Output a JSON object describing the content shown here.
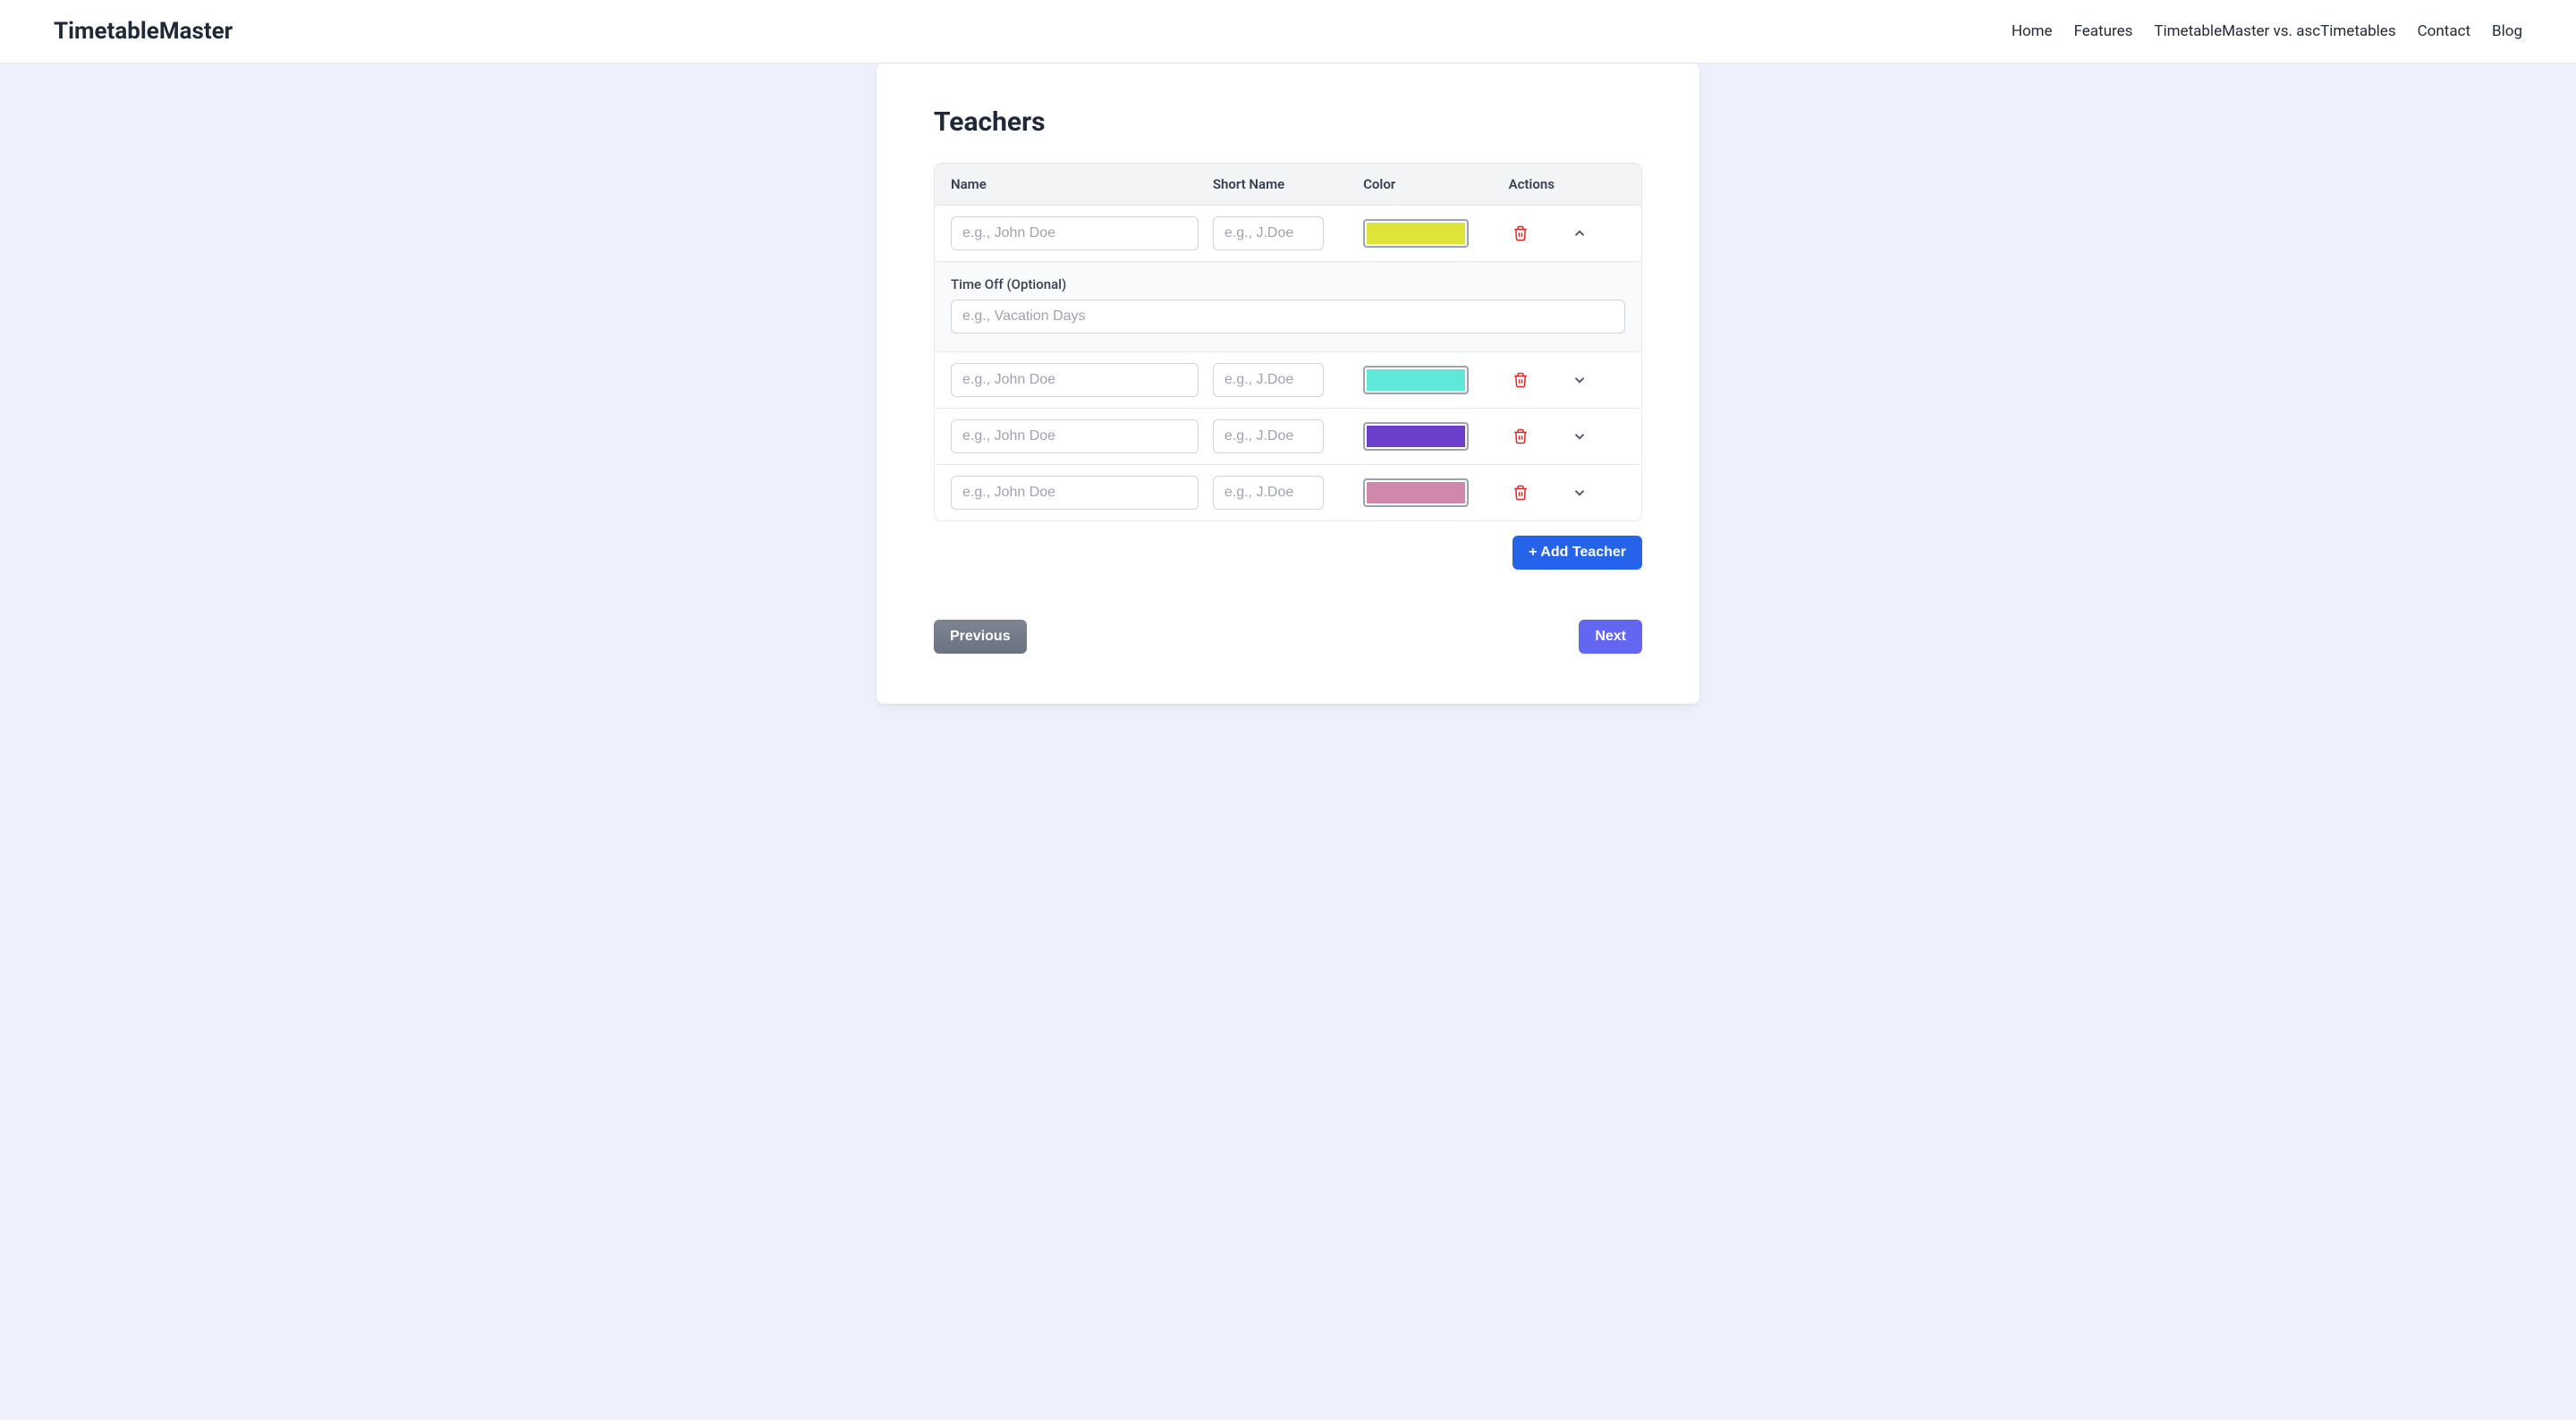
{
  "nav": {
    "logo": "TimetableMaster",
    "links": [
      "Home",
      "Features",
      "TimetableMaster vs. ascTimetables",
      "Contact",
      "Blog"
    ]
  },
  "card": {
    "title": "Teachers",
    "columns": [
      "Name",
      "Short Name",
      "Color",
      "Actions"
    ],
    "name_placeholder": "e.g., John Doe",
    "short_name_placeholder": "e.g., J.Doe",
    "timeoff_label": "Time Off (Optional)",
    "timeoff_placeholder": "e.g., Vacation Days",
    "rows": [
      {
        "color": "#dde53b",
        "expanded": true
      },
      {
        "color": "#5fe7da",
        "expanded": false
      },
      {
        "color": "#6a3fc9",
        "expanded": false
      },
      {
        "color": "#cf87ac",
        "expanded": false
      }
    ],
    "add_button": "+ Add Teacher",
    "prev_button": "Previous",
    "next_button": "Next"
  }
}
